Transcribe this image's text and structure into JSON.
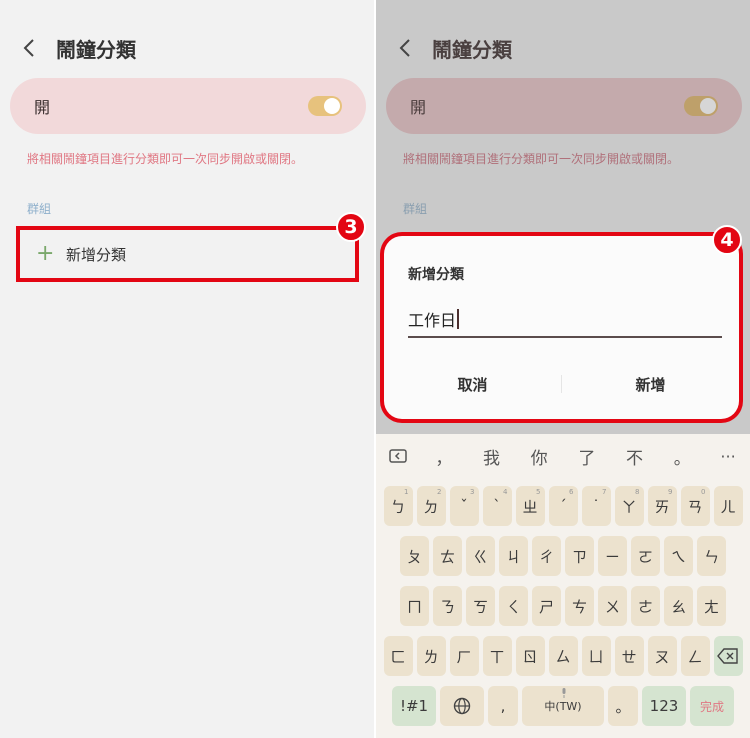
{
  "left": {
    "header": {
      "title": "鬧鐘分類"
    },
    "toggle": {
      "label": "開",
      "state": "on"
    },
    "description": "將相關鬧鐘項目進行分類即可一次同步開啟或關閉。",
    "group_label": "群組",
    "add_category_label": "新增分類",
    "badge": "3"
  },
  "right": {
    "header": {
      "title": "鬧鐘分類"
    },
    "toggle": {
      "label": "開",
      "state": "on"
    },
    "description": "將相關鬧鐘項目進行分類即可一次同步開啟或關閉。",
    "group_label": "群組",
    "badge": "4",
    "dialog": {
      "title": "新增分類",
      "input_value": "工作日",
      "cancel_label": "取消",
      "add_label": "新增"
    },
    "keyboard": {
      "suggestions": [
        "，",
        "我",
        "你",
        "了",
        "不",
        "。"
      ],
      "row1": [
        {
          "k": "ㄅ",
          "h": "1"
        },
        {
          "k": "ㄉ",
          "h": "2"
        },
        {
          "k": "ˇ",
          "h": "3"
        },
        {
          "k": "ˋ",
          "h": "4"
        },
        {
          "k": "ㄓ",
          "h": "5"
        },
        {
          "k": "ˊ",
          "h": "6"
        },
        {
          "k": "˙",
          "h": "7"
        },
        {
          "k": "ㄚ",
          "h": "8"
        },
        {
          "k": "ㄞ",
          "h": "9"
        },
        {
          "k": "ㄢ",
          "h": "0"
        },
        {
          "k": "ㄦ",
          "h": ""
        }
      ],
      "row2": [
        "ㄆ",
        "ㄊ",
        "ㄍ",
        "ㄐ",
        "ㄔ",
        "ㄗ",
        "ㄧ",
        "ㄛ",
        "ㄟ",
        "ㄣ"
      ],
      "row3": [
        "ㄇ",
        "ㄋ",
        "ㄎ",
        "ㄑ",
        "ㄕ",
        "ㄘ",
        "ㄨ",
        "ㄜ",
        "ㄠ",
        "ㄤ"
      ],
      "row4": [
        "ㄈ",
        "ㄌ",
        "ㄏ",
        "ㄒ",
        "ㄖ",
        "ㄙ",
        "ㄩ",
        "ㄝ",
        "ㄡ",
        "ㄥ"
      ],
      "symbols_label": "!#1",
      "comma_label": ",",
      "space_label": "中(TW)",
      "period_label": "。",
      "numbers_label": "123",
      "done_label": "完成"
    }
  }
}
